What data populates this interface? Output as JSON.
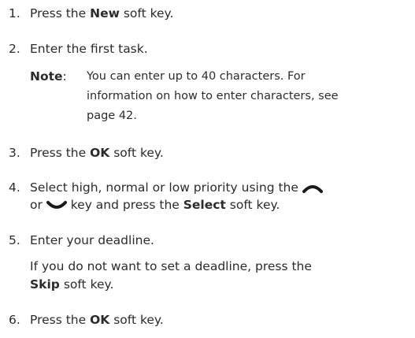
{
  "steps": [
    {
      "num": "1.",
      "pre": "Press the ",
      "bold": "New",
      "post": " soft key."
    },
    {
      "num": "2.",
      "text": "Enter the first task."
    },
    {
      "num": "3.",
      "pre": "Press the ",
      "bold": "OK",
      "post": " soft key."
    },
    {
      "num": "4.",
      "line1": "Select high, normal or low priority using the",
      "line2_pre": "or",
      "line2_mid": "key and press the ",
      "line2_bold": "Select",
      "line2_post": " soft key."
    },
    {
      "num": "5.",
      "text": "Enter your deadline.",
      "sub_line1": "If you do not want to set a deadline, press the",
      "sub_line2_bold": "Skip",
      "sub_line2_post": " soft key."
    },
    {
      "num": "6.",
      "pre": "Press the ",
      "bold": "OK",
      "post": " soft key."
    }
  ],
  "note": {
    "label": "Note",
    "colon": ":",
    "line1": "You can enter up to 40 characters. For",
    "line2": "information on how to enter characters, see",
    "line3": "page 42."
  },
  "icons": {
    "up_key": "up-arrow-key-icon",
    "down_key": "down-arrow-key-icon"
  }
}
